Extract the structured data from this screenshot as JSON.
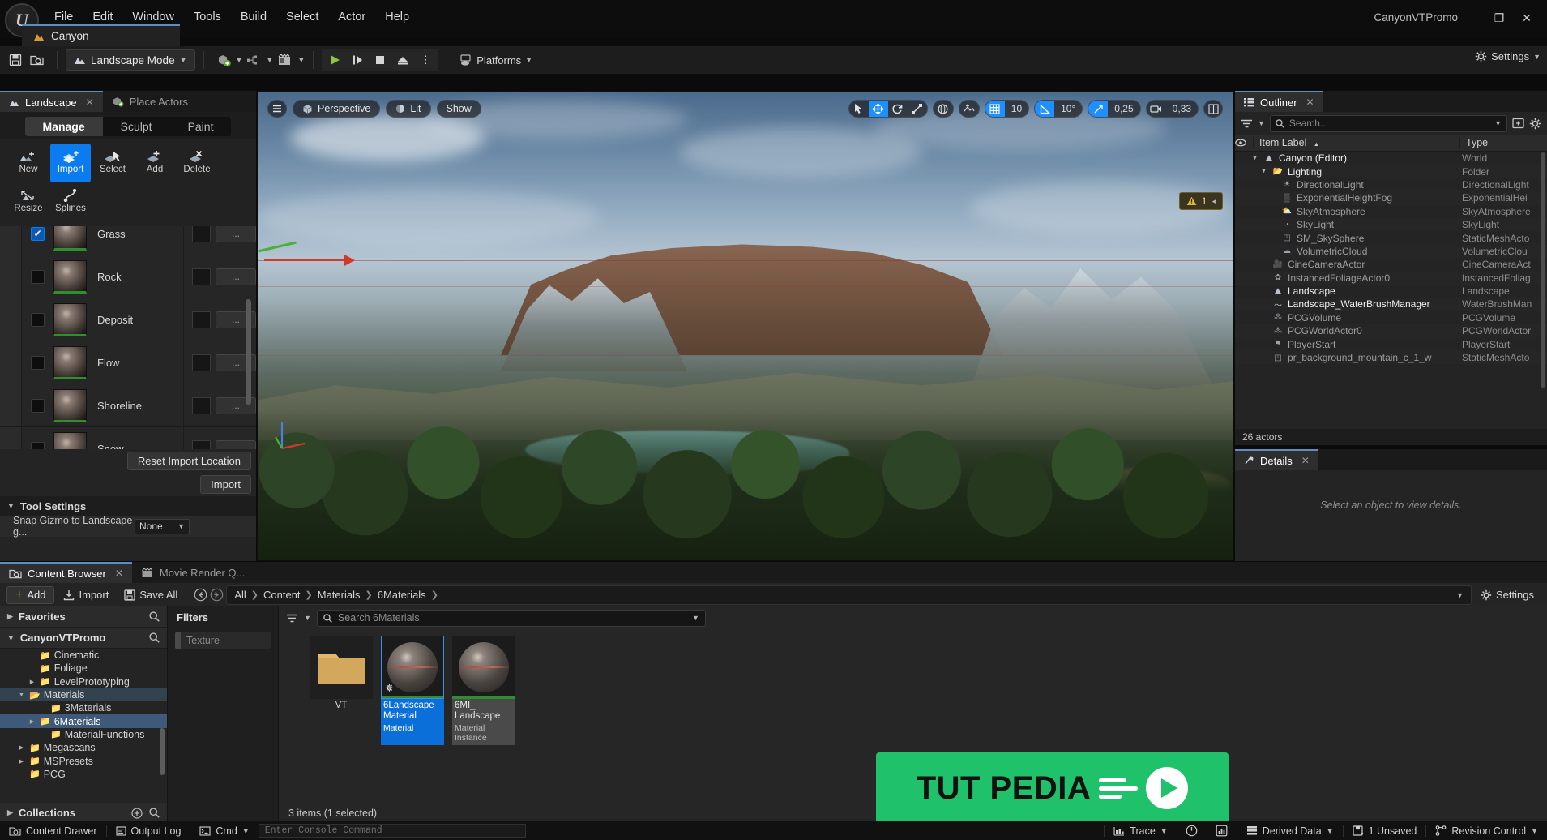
{
  "window": {
    "project_title": "CanyonVTPromo",
    "minimize": "–",
    "maximize": "❐",
    "close": "✕"
  },
  "menu": {
    "items": [
      "File",
      "Edit",
      "Window",
      "Tools",
      "Build",
      "Select",
      "Actor",
      "Help"
    ]
  },
  "level_tab": {
    "label": "Canyon",
    "icon": "landscape-icon"
  },
  "toolbar": {
    "save_icon": "save-icon",
    "browse_icon": "browse-content-icon",
    "mode_label": "Landscape Mode",
    "quick_add_icon": "add-actor-icon",
    "blueprints_icon": "blueprints-icon",
    "cinematics_icon": "cinematics-icon",
    "play_icon": "▶",
    "skip_icon": "⏸",
    "stop_icon": "■",
    "eject_icon": "▲",
    "more_icon": "⋮",
    "platforms_label": "Platforms",
    "settings_label": "Settings"
  },
  "left_panel": {
    "tabs": [
      {
        "label": "Landscape",
        "icon": "landscape-icon",
        "active": true,
        "closable": true
      },
      {
        "label": "Place Actors",
        "icon": "place-actors-icon",
        "active": false,
        "closable": false
      }
    ],
    "segments": [
      {
        "label": "Manage",
        "active": true
      },
      {
        "label": "Sculpt",
        "active": false
      },
      {
        "label": "Paint",
        "active": false
      }
    ],
    "tools_row1": [
      {
        "label": "New",
        "icon": "landscape-new-icon",
        "selected": false
      },
      {
        "label": "Import",
        "icon": "landscape-import-icon",
        "selected": true
      },
      {
        "label": "Select",
        "icon": "landscape-select-icon",
        "selected": false
      },
      {
        "label": "Add",
        "icon": "landscape-add-icon",
        "selected": false
      },
      {
        "label": "Delete",
        "icon": "landscape-delete-icon",
        "selected": false
      }
    ],
    "tools_row2": [
      {
        "label": "Resize",
        "icon": "landscape-resize-icon",
        "selected": false
      },
      {
        "label": "Splines",
        "icon": "landscape-splines-icon",
        "selected": false
      }
    ],
    "layers": [
      {
        "name": "Grass",
        "checked": true,
        "ellipsis": "..."
      },
      {
        "name": "Rock",
        "checked": false,
        "ellipsis": "..."
      },
      {
        "name": "Deposit",
        "checked": false,
        "ellipsis": "..."
      },
      {
        "name": "Flow",
        "checked": false,
        "ellipsis": "..."
      },
      {
        "name": "Shoreline",
        "checked": false,
        "ellipsis": "..."
      },
      {
        "name": "Snow",
        "checked": false,
        "ellipsis": "..."
      }
    ],
    "reset_button": "Reset Import Location",
    "import_button": "Import",
    "tool_settings_header": "Tool Settings",
    "snap_label": "Snap Gizmo to Landscape g...",
    "snap_value": "None"
  },
  "viewport": {
    "menu_icon": "viewport-menu-icon",
    "camera_mode": "Perspective",
    "view_mode": "Lit",
    "show_menu": "Show",
    "warning_count": "1",
    "transform_tools": [
      {
        "icon": "select-arrow-icon",
        "active": false
      },
      {
        "icon": "move-icon",
        "active": true
      },
      {
        "icon": "rotate-icon",
        "active": false
      },
      {
        "icon": "scale-icon",
        "active": false
      }
    ],
    "coord_icon": "world-coordinate-icon",
    "surface_snap_icon": "surface-snap-icon",
    "grid_snap": {
      "icon": "grid-snap-icon",
      "value": "10",
      "active": true
    },
    "angle_snap": {
      "icon": "angle-snap-icon",
      "value": "10°",
      "active": true
    },
    "scale_snap": {
      "icon": "scale-snap-icon",
      "value": "0,25",
      "active": true
    },
    "camera_speed": {
      "icon": "camera-speed-icon",
      "value": "0,33",
      "active": false
    },
    "layout_icon": "viewport-layout-icon"
  },
  "outliner": {
    "tab_label": "Outliner",
    "tab_icon": "outliner-icon",
    "close_icon": "✕",
    "filter_icon": "filter-icon",
    "search_placeholder": "Search...",
    "save_icon": "save-preset-icon",
    "settings_icon": "gear-icon",
    "visibility_icon": "eye-icon",
    "columns": [
      "Item Label",
      "Type"
    ],
    "sort_indicator": "▲",
    "rows": [
      {
        "label": "Canyon (Editor)",
        "type": "World",
        "indent": 1,
        "twisty": "down",
        "icon": "world-icon",
        "dim": false
      },
      {
        "label": "Lighting",
        "type": "Folder",
        "indent": 2,
        "twisty": "down",
        "icon": "folder-icon",
        "dim": false
      },
      {
        "label": "DirectionalLight",
        "type": "DirectionalLight",
        "indent": 3,
        "twisty": "",
        "icon": "light-icon",
        "dim": true
      },
      {
        "label": "ExponentialHeightFog",
        "type": "ExponentialHei",
        "indent": 3,
        "twisty": "",
        "icon": "fog-icon",
        "dim": true
      },
      {
        "label": "SkyAtmosphere",
        "type": "SkyAtmosphere",
        "indent": 3,
        "twisty": "",
        "icon": "sky-icon",
        "dim": true
      },
      {
        "label": "SkyLight",
        "type": "SkyLight",
        "indent": 3,
        "twisty": "",
        "icon": "skylight-icon",
        "dim": true
      },
      {
        "label": "SM_SkySphere",
        "type": "StaticMeshActo",
        "indent": 3,
        "twisty": "",
        "icon": "mesh-icon",
        "dim": true
      },
      {
        "label": "VolumetricCloud",
        "type": "VolumetricClou",
        "indent": 3,
        "twisty": "",
        "icon": "cloud-icon",
        "dim": true
      },
      {
        "label": "CineCameraActor",
        "type": "CineCameraAct",
        "indent": 2,
        "twisty": "",
        "icon": "camera-icon",
        "dim": true
      },
      {
        "label": "InstancedFoliageActor0",
        "type": "InstancedFoliag",
        "indent": 2,
        "twisty": "",
        "icon": "foliage-icon",
        "dim": true
      },
      {
        "label": "Landscape",
        "type": "Landscape",
        "indent": 2,
        "twisty": "",
        "icon": "landscape-icon",
        "dim": false
      },
      {
        "label": "Landscape_WaterBrushManager",
        "type": "WaterBrushMan",
        "indent": 2,
        "twisty": "",
        "icon": "waterbrush-icon",
        "dim": false
      },
      {
        "label": "PCGVolume",
        "type": "PCGVolume",
        "indent": 2,
        "twisty": "",
        "icon": "pcg-icon",
        "dim": true
      },
      {
        "label": "PCGWorldActor0",
        "type": "PCGWorldActor",
        "indent": 2,
        "twisty": "",
        "icon": "pcg-icon",
        "dim": true
      },
      {
        "label": "PlayerStart",
        "type": "PlayerStart",
        "indent": 2,
        "twisty": "",
        "icon": "playerstart-icon",
        "dim": true
      },
      {
        "label": "pr_background_mountain_c_1_w",
        "type": "StaticMeshActo",
        "indent": 2,
        "twisty": "",
        "icon": "mesh-icon",
        "dim": true
      }
    ],
    "footer": "26 actors"
  },
  "details": {
    "tab_label": "Details",
    "tab_icon": "details-icon",
    "close_icon": "✕",
    "empty_message": "Select an object to view details."
  },
  "content_browser": {
    "tabs": [
      {
        "label": "Content Browser",
        "icon": "content-browser-icon",
        "active": true,
        "closable": true
      },
      {
        "label": "Movie Render Q...",
        "icon": "movie-render-icon",
        "active": false,
        "closable": false
      }
    ],
    "add_label": "Add",
    "import_label": "Import",
    "save_all_label": "Save All",
    "nav_back_icon": "arrow-left-circle-icon",
    "nav_forward_icon": "arrow-right-circle-icon",
    "breadcrumbs": [
      "All",
      "Content",
      "Materials",
      "6Materials"
    ],
    "settings_label": "Settings",
    "favorites_label": "Favorites",
    "project_label": "CanyonVTPromo",
    "collections_label": "Collections",
    "search_icon": "search-icon",
    "tree": [
      {
        "label": "Cinematic",
        "indent": 2,
        "twisty": "",
        "state": "none"
      },
      {
        "label": "Foliage",
        "indent": 2,
        "twisty": "",
        "state": "none"
      },
      {
        "label": "LevelPrototyping",
        "indent": 2,
        "twisty": "right",
        "state": "none"
      },
      {
        "label": "Materials",
        "indent": 1,
        "twisty": "down",
        "state": "hl"
      },
      {
        "label": "3Materials",
        "indent": 3,
        "twisty": "",
        "state": "none"
      },
      {
        "label": "6Materials",
        "indent": 2,
        "twisty": "right",
        "state": "sel"
      },
      {
        "label": "MaterialFunctions",
        "indent": 3,
        "twisty": "",
        "state": "none"
      },
      {
        "label": "Megascans",
        "indent": 1,
        "twisty": "right",
        "state": "none"
      },
      {
        "label": "MSPresets",
        "indent": 1,
        "twisty": "right",
        "state": "none"
      },
      {
        "label": "PCG",
        "indent": 1,
        "twisty": "",
        "state": "none"
      }
    ],
    "filters_header": "Filters",
    "filter_chips": [
      {
        "label": "Texture"
      }
    ],
    "asset_search_placeholder": "Search 6Materials",
    "asset_view_icon": "view-options-icon",
    "assets": [
      {
        "name": "VT",
        "type": "",
        "kind": "folder",
        "selected": false
      },
      {
        "name": "6Landscape Material",
        "type": "Material",
        "kind": "material",
        "selected": true
      },
      {
        "name": "6MI_ Landscape",
        "type": "Material Instance",
        "kind": "material-instance",
        "selected": false
      }
    ],
    "items_count": "3 items (1 selected)"
  },
  "watermark": {
    "text": "TUT PEDIA"
  },
  "status_bar": {
    "content_drawer": "Content Drawer",
    "output_log": "Output Log",
    "cmd_label": "Cmd",
    "console_placeholder": "Enter Console Command",
    "trace_label": "Trace",
    "derived_data_label": "Derived Data",
    "unsaved_label": "1 Unsaved",
    "revision_control_label": "Revision Control"
  },
  "colors": {
    "accent_blue": "#0a7cf0",
    "viewport_highlight": "#1e8fff",
    "selection_blue": "#0a6fd8",
    "warning_yellow": "#e8d48a",
    "watermark_green": "#1fc26b",
    "folder_gold": "#cfa255"
  }
}
